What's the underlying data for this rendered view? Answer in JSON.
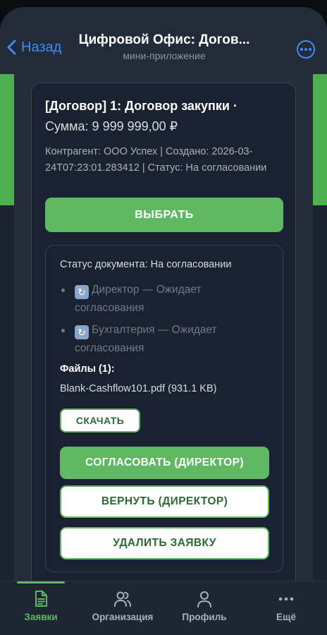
{
  "header": {
    "back_label": "Назад",
    "title": "Цифровой Офис: Догов...",
    "subtitle": "мини-приложение"
  },
  "card": {
    "title": "[Договор] 1: Договор закупки ·",
    "sum": "Сумма: 9 999 999,00 ₽",
    "meta": "Контрагент: ООО Успех | Создано: 2026-03-24T07:23:01.283412 | Статус: На согласовании",
    "select_label": "ВЫБРАТЬ"
  },
  "details": {
    "doc_status": "Статус документа: На согласовании",
    "approvals": [
      {
        "icon": "refresh-icon",
        "text": "Директор — Ожидает согласования"
      },
      {
        "icon": "refresh-icon",
        "text": "Бухгалтерия — Ожидает согласования"
      }
    ],
    "files_title": "Файлы (1):",
    "file_name": "Blank-Cashflow101.pdf (931.1 KB)",
    "download_label": "СКАЧАТЬ",
    "approve_label": "СОГЛАСОВАТЬ (ДИРЕКТОР)",
    "return_label": "ВЕРНУТЬ (ДИРЕКТОР)",
    "delete_label": "УДАЛИТЬ ЗАЯВКУ"
  },
  "tabs": [
    {
      "label": "Заявки",
      "icon": "document-icon",
      "active": true
    },
    {
      "label": "Организация",
      "icon": "users-icon",
      "active": false
    },
    {
      "label": "Профиль",
      "icon": "user-icon",
      "active": false
    },
    {
      "label": "Ещё",
      "icon": "more-icon",
      "active": false
    }
  ],
  "colors": {
    "accent": "#5fb962",
    "link": "#3c8ef5",
    "background": "#1b2230"
  }
}
